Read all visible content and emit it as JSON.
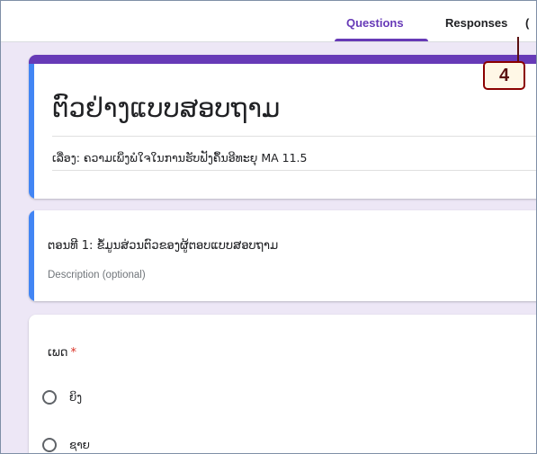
{
  "tabs": {
    "questions": "Questions",
    "responses": "Responses",
    "overflow": "("
  },
  "form": {
    "title": "ຕົວຢ່າງແບບສອບຖາມ",
    "description": "ເລື່ອງ: ຄວາມເພິ່ງພໍໃຈໃນການຮັບຟັງຄຶ້ນອີທະຍຸ MA 11.5"
  },
  "section": {
    "title": "ຕອນທີ 1: ຂໍ້ມູນສ່ວນຕົວຂອງຜູ້ຕອບແບບສອບຖາມ",
    "description_placeholder": "Description (optional)"
  },
  "question": {
    "label": "ເພດ",
    "required_mark": "*",
    "options": [
      "ຍິງ",
      "ຊາຍ"
    ]
  },
  "callout": {
    "number": "4"
  },
  "colors": {
    "accent": "#673ab7",
    "section_edge": "#4285f4",
    "background": "#ede7f6",
    "callout_border": "#8b0000"
  }
}
